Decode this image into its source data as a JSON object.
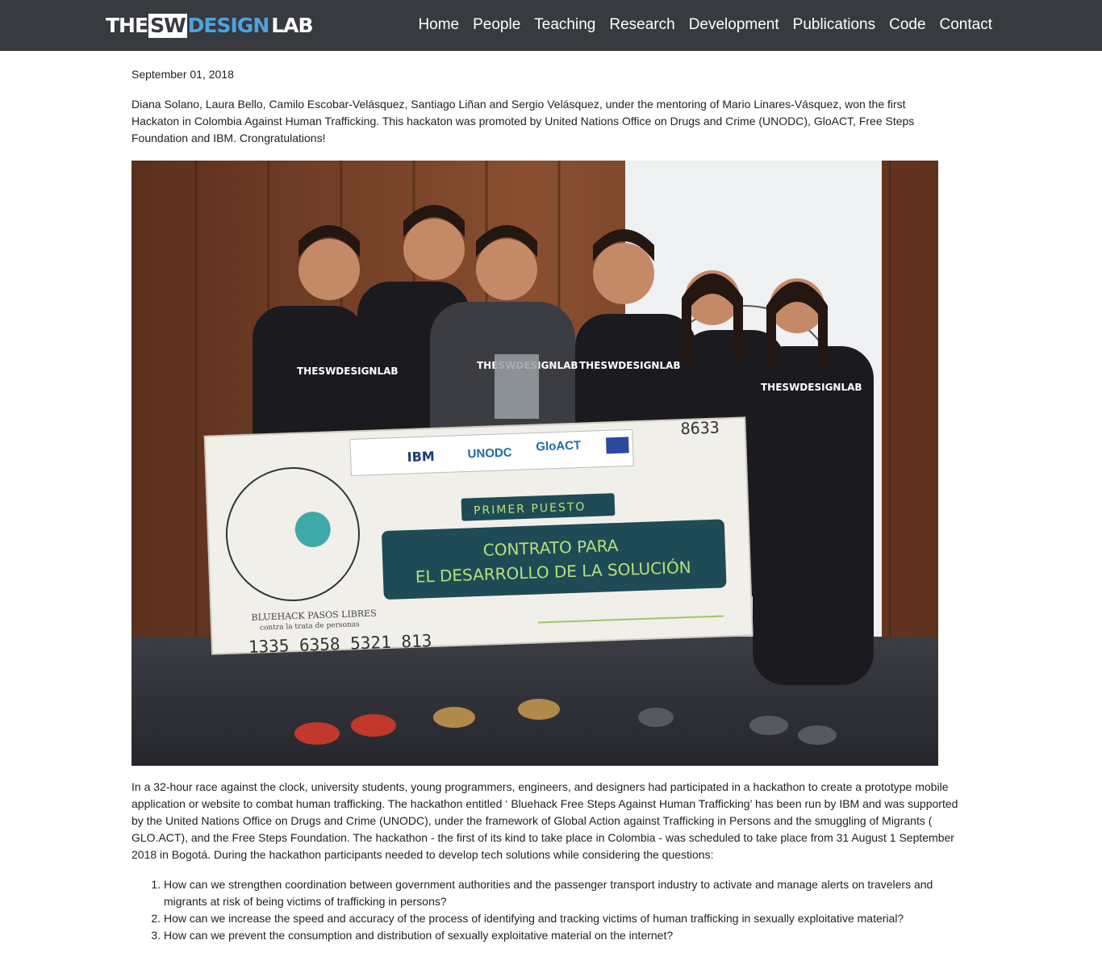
{
  "brand": {
    "logo_the": "THE",
    "logo_sw": "SW",
    "logo_design": "DESIGN",
    "logo_lab": "LAB"
  },
  "nav": {
    "items": [
      {
        "label": "Home"
      },
      {
        "label": "People"
      },
      {
        "label": "Teaching"
      },
      {
        "label": "Research"
      },
      {
        "label": "Development"
      },
      {
        "label": "Publications"
      },
      {
        "label": "Code"
      },
      {
        "label": "Contact"
      }
    ]
  },
  "post": {
    "date": "September 01, 2018",
    "intro": "Diana Solano, Laura Bello, Camilo Escobar-Velásquez, Santiago Liñan and Sergio Velásquez, under the mentoring of Mario Linares-Vásquez, won the first Hackaton in Colombia Against Human Trafficking. This hackaton was promoted by United Nations Office on Drugs and Crime (UNODC), GloACT, Free Steps Foundation and IBM. Crongratulations!",
    "photo": {
      "check_number": "8633",
      "check_title": "PRIMER PUESTO",
      "check_line1": "CONTRATO PARA",
      "check_line2": "EL DESARROLLO DE LA SOLUCIÓN",
      "check_account": "1335 6358 5321 813",
      "check_brand": "BLUEHACK PASOS LIBRES",
      "check_brand_sub": "contra la trata de personas",
      "sponsor_ibm": "IBM",
      "sponsor_unodc": "UNODC",
      "sponsor_gloact": "GloACT",
      "shirt_text": "THESWDESIGNLAB"
    },
    "body": "In a 32-hour race against the clock, university students, young programmers, engineers, and designers had participated in a hackathon to create a prototype mobile application or website to combat human trafficking. The hackathon entitled ‘ Bluehack Free Steps Against Human Trafficking’ has been run by IBM and was supported by the United Nations Office on Drugs and Crime (UNODC), under the framework of Global Action against Trafficking in Persons and the smuggling of Migrants ( GLO.ACT), and the Free Steps Foundation. The hackathon - the first of its kind to take place in Colombia - was scheduled to take place from 31 August 1 September 2018 in Bogotá. During the hackathon participants needed to develop tech solutions while considering the questions:",
    "questions": [
      "How can we strengthen coordination between government authorities and the passenger transport industry to activate and manage alerts on travelers and migrants at risk of being victims of trafficking in persons?",
      "How can we increase the speed and accuracy of the process of identifying and tracking victims of human trafficking in sexually exploitative material?",
      "How can we prevent the consumption and distribution of sexually exploitative material on the internet?"
    ]
  },
  "colors": {
    "navbar_bg": "#373a3f",
    "accent": "#4ea4dd",
    "check_panel": "#1f4b56",
    "check_text": "#b6e07a"
  }
}
